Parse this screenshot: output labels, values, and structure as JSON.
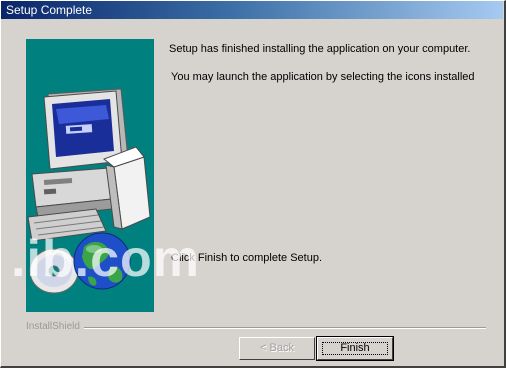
{
  "window": {
    "title": "Setup Complete"
  },
  "messages": {
    "line1": "Setup has finished installing the application on your computer.",
    "line2": "You may launch the application by selecting the icons installed",
    "line3": "Click Finish to complete Setup."
  },
  "branding": {
    "label": "InstallShield"
  },
  "buttons": {
    "back": "< Back",
    "finish": "Finish"
  },
  "watermark": {
    "text": ".ib.com"
  },
  "colors": {
    "panel_teal": "#00807f",
    "dialog_gray": "#d6d3ce",
    "title_blue": "#0a246a"
  },
  "icons": [
    "computer-icon",
    "globe-icon",
    "cd-icon"
  ]
}
